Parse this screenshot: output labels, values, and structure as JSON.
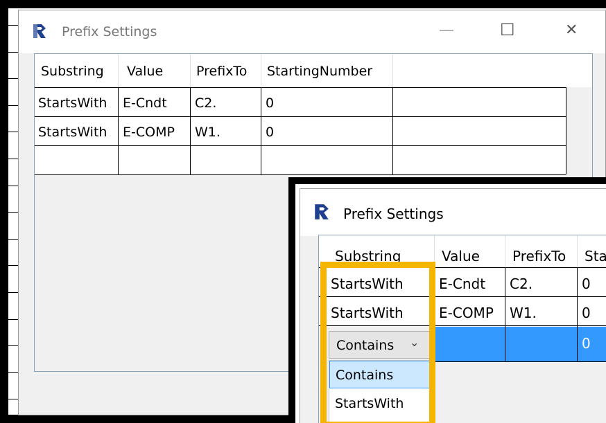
{
  "back_window": {
    "title": "Prefix Settings",
    "controls": {
      "minimize": "—",
      "maximize": "☐",
      "close": "✕"
    },
    "columns": [
      "Substring",
      "Value",
      "PrefixTo",
      "StartingNumber"
    ],
    "rows": [
      [
        "StartsWith",
        "E-Cndt",
        "C2.",
        "0"
      ],
      [
        "StartsWith",
        "E-COMP",
        "W1.",
        "0"
      ],
      [
        "",
        "",
        "",
        ""
      ]
    ]
  },
  "front_window": {
    "title": "Prefix Settings",
    "columns": [
      "Substring",
      "Value",
      "PrefixTo",
      "Sta"
    ],
    "rows": [
      [
        "StartsWith",
        "E-Cndt",
        "C2.",
        "0"
      ],
      [
        "StartsWith",
        "E-COMP",
        "W1.",
        "0"
      ]
    ],
    "new_row": {
      "combo_value": "Contains",
      "starting_number": "0"
    },
    "dropdown_options": [
      "Contains",
      "StartsWith"
    ],
    "dropdown_selected": "Contains"
  },
  "colors": {
    "selection": "#3399ff",
    "highlight_border": "#f5b400",
    "dropdown_hover": "#cce8ff"
  }
}
